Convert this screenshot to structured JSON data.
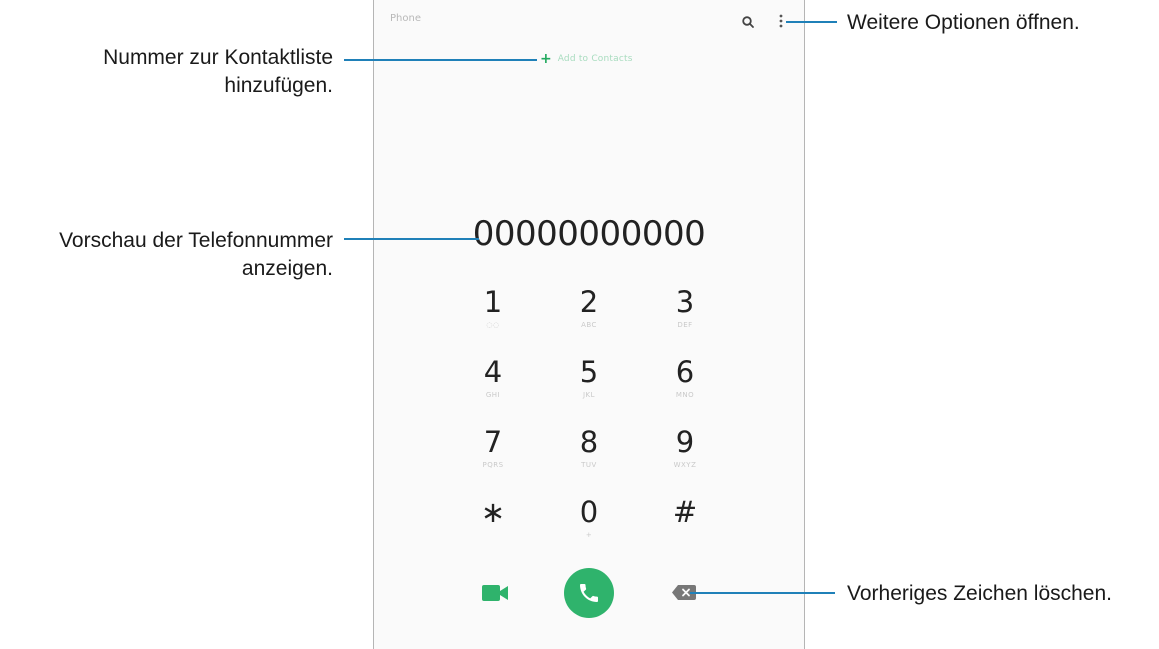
{
  "phone": {
    "app_title": "Phone",
    "add_contact_label": "Add to Contacts",
    "number_preview": "00000000000",
    "keypad": [
      {
        "digit": "1",
        "letters": "◌◌"
      },
      {
        "digit": "2",
        "letters": "ABC"
      },
      {
        "digit": "3",
        "letters": "DEF"
      },
      {
        "digit": "4",
        "letters": "GHI"
      },
      {
        "digit": "5",
        "letters": "JKL"
      },
      {
        "digit": "6",
        "letters": "MNO"
      },
      {
        "digit": "7",
        "letters": "PQRS"
      },
      {
        "digit": "8",
        "letters": "TUV"
      },
      {
        "digit": "9",
        "letters": "WXYZ"
      },
      {
        "digit": "∗",
        "letters": ""
      },
      {
        "digit": "0",
        "letters": "+"
      },
      {
        "digit": "#",
        "letters": ""
      }
    ],
    "icons": {
      "search": "search-icon",
      "more": "more-vertical-icon",
      "add": "plus-icon",
      "video": "video-camera-icon",
      "call": "phone-icon",
      "backspace": "backspace-icon"
    }
  },
  "callouts": {
    "add_contact_line1": "Nummer zur Kontaktliste",
    "add_contact_line2": "hinzufügen.",
    "preview_line1": "Vorschau der Telefonnummer",
    "preview_line2": "anzeigen.",
    "more_options": "Weitere Optionen öffnen.",
    "delete_char": "Vorheriges Zeichen löschen."
  },
  "colors": {
    "accent_green": "#2fb36c",
    "callout_line": "#1f80b8",
    "icon_gray": "#777777"
  }
}
